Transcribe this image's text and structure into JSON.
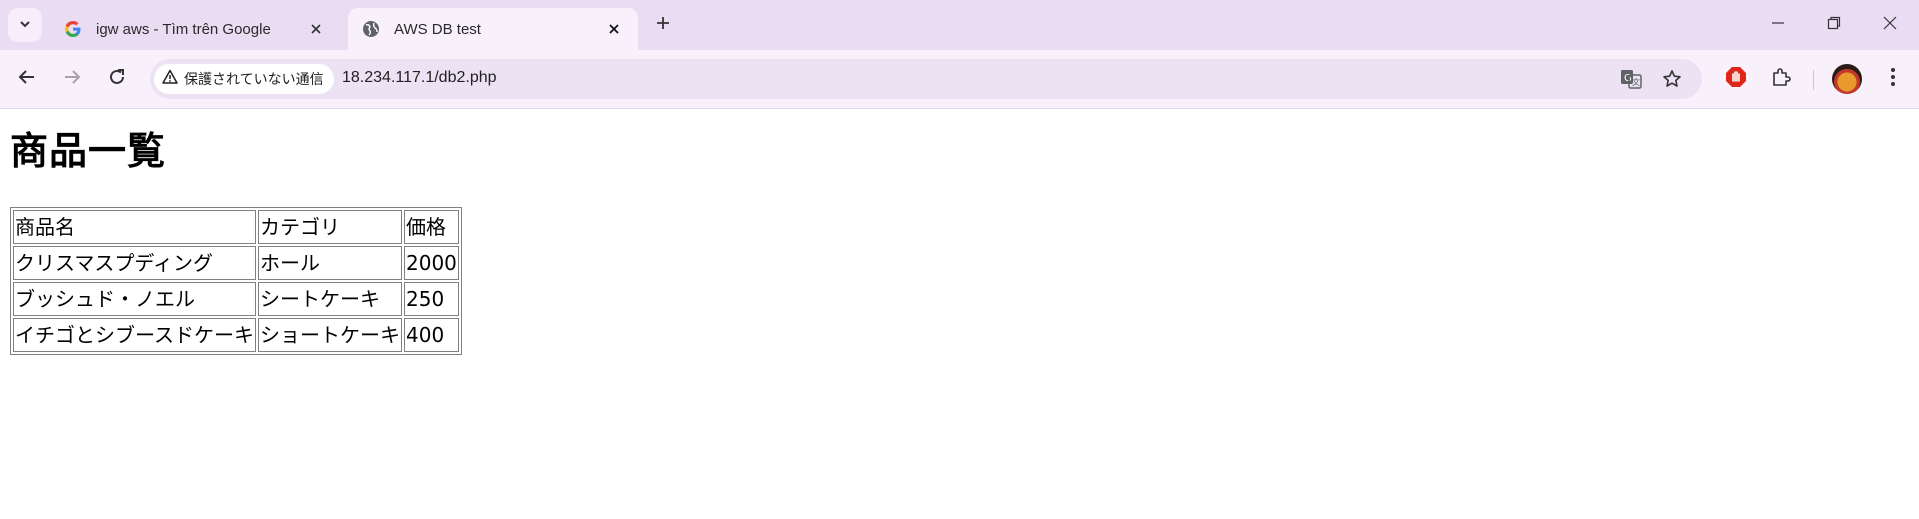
{
  "browser": {
    "tabs": [
      {
        "title": "igw aws - Tìm trên Google",
        "active": false,
        "favicon": "google-g-icon"
      },
      {
        "title": "AWS DB test",
        "active": true,
        "favicon": "globe-icon"
      }
    ],
    "address_bar": {
      "security_chip": "保護されていない通信",
      "url": "18.234.117.1/db2.php"
    }
  },
  "page": {
    "title": "商品一覧",
    "table": {
      "headers": [
        "商品名",
        "カテゴリ",
        "価格"
      ],
      "rows": [
        [
          "クリスマスプディング",
          "ホール",
          "2000"
        ],
        [
          "ブッシュド・ノエル",
          "シートケーキ",
          "250"
        ],
        [
          "イチゴとシブースドケーキ",
          "ショートケーキ",
          "400"
        ]
      ]
    }
  },
  "colors": {
    "tabstrip_bg": "#e9dcf3",
    "toolbar_bg": "#f8f1fc",
    "omnibox_bg": "#ece2f3"
  }
}
